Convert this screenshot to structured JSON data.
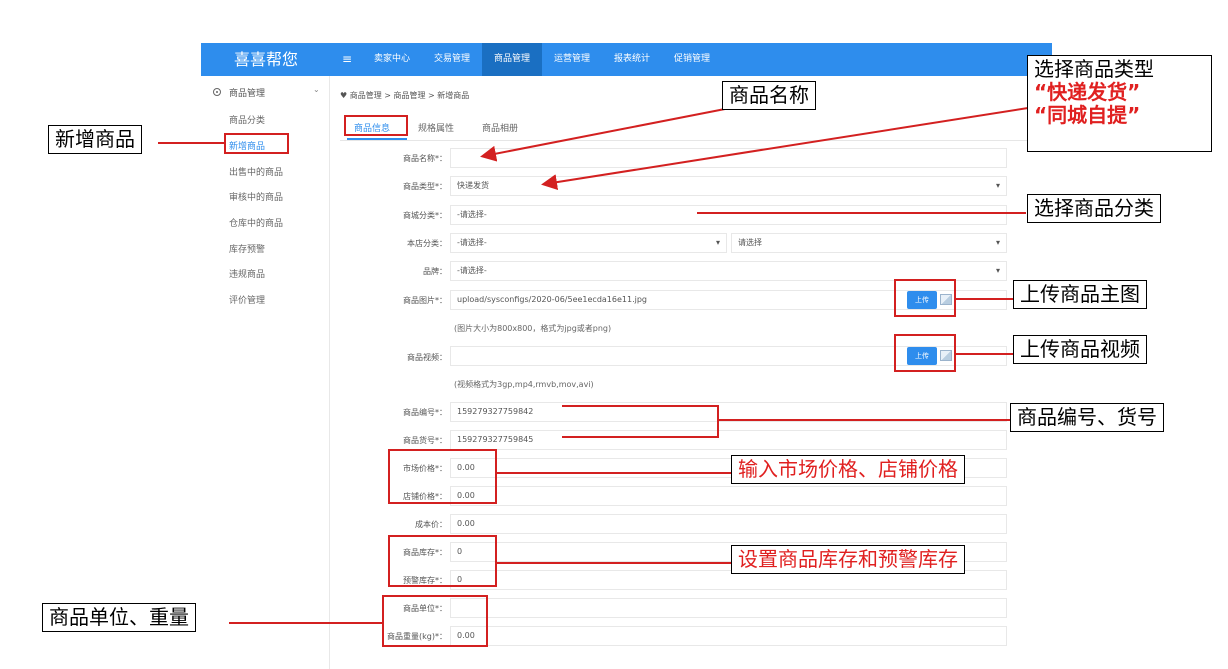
{
  "navbar": {
    "brand": "喜喜帮您",
    "menu_icon": "≡",
    "items": [
      {
        "label": "卖家中心",
        "active": false
      },
      {
        "label": "交易管理",
        "active": false
      },
      {
        "label": "商品管理",
        "active": true
      },
      {
        "label": "运营管理",
        "active": false
      },
      {
        "label": "报表统计",
        "active": false
      },
      {
        "label": "促销管理",
        "active": false
      }
    ]
  },
  "sidebar": {
    "header": "商品管理",
    "items": [
      {
        "label": "商品分类"
      },
      {
        "label": "新增商品",
        "active": true
      },
      {
        "label": "出售中的商品"
      },
      {
        "label": "审核中的商品"
      },
      {
        "label": "仓库中的商品"
      },
      {
        "label": "库存预警"
      },
      {
        "label": "违规商品"
      },
      {
        "label": "评价管理"
      }
    ]
  },
  "breadcrumb": "♥ 商品管理 > 商品管理 > 新增商品",
  "tabs": [
    {
      "label": "商品信息",
      "active": true
    },
    {
      "label": "规格属性"
    },
    {
      "label": "商品相册"
    }
  ],
  "form": {
    "name_label": "商品名称*：",
    "name_value": "",
    "type_label": "商品类型*：",
    "type_value": "快递发货",
    "mall_cat_label": "商城分类*：",
    "mall_cat_value": "-请选择-",
    "store_cat_label": "本店分类：",
    "store_cat_value": "-请选择-",
    "store_cat_value2": "请选择",
    "brand_label": "品牌：",
    "brand_value": "-请选择-",
    "image_label": "商品图片*：",
    "image_value": "upload/sysconfigs/2020-06/5ee1ecda16e11.jpg",
    "image_hint": "(图片大小为800x800，格式为jpg或者png)",
    "upload_label": "上传",
    "video_label": "商品视频：",
    "video_value": "",
    "video_hint": "(视频格式为3gp,mp4,rmvb,mov,avi)",
    "sku_label": "商品编号*：",
    "sku_value": "159279327759842",
    "code_label": "商品货号*：",
    "code_value": "159279327759845",
    "market_price_label": "市场价格*：",
    "market_price_value": "0.00",
    "shop_price_label": "店铺价格*：",
    "shop_price_value": "0.00",
    "cost_label": "成本价：",
    "cost_value": "0.00",
    "stock_label": "商品库存*：",
    "stock_value": "0",
    "warn_stock_label": "预警库存*：",
    "warn_stock_value": "0",
    "unit_label": "商品单位*：",
    "unit_value": "",
    "weight_label": "商品重量(kg)*：",
    "weight_value": "0.00"
  },
  "annotations": {
    "new_product": "新增商品",
    "product_name": "商品名称",
    "select_type_title": "选择商品类型",
    "select_type_opt1": "“快递发货”",
    "select_type_opt2": "“同城自提”",
    "select_category": "选择商品分类",
    "upload_main_image": "上传商品主图",
    "upload_video": "上传商品视频",
    "sku_code": "商品编号、货号",
    "price": "输入市场价格、店铺价格",
    "stock": "设置商品库存和预警库存",
    "unit_weight": "商品单位、重量"
  },
  "colors": {
    "navbar": "#2e8ded",
    "navbar_active": "#1a6fc2",
    "annotation_red": "#d32020"
  }
}
